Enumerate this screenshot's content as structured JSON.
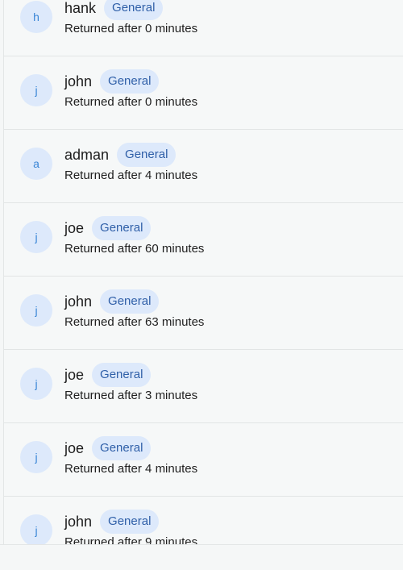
{
  "items": [
    {
      "initial": "h",
      "name": "hank",
      "badge": "General",
      "status": "Returned after 0 minutes"
    },
    {
      "initial": "j",
      "name": "john",
      "badge": "General",
      "status": "Returned after 0 minutes"
    },
    {
      "initial": "a",
      "name": "adman",
      "badge": "General",
      "status": "Returned after 4 minutes"
    },
    {
      "initial": "j",
      "name": "joe",
      "badge": "General",
      "status": "Returned after 60 minutes"
    },
    {
      "initial": "j",
      "name": "john",
      "badge": "General",
      "status": "Returned after 63 minutes"
    },
    {
      "initial": "j",
      "name": "joe",
      "badge": "General",
      "status": "Returned after 3 minutes"
    },
    {
      "initial": "j",
      "name": "joe",
      "badge": "General",
      "status": "Returned after 4 minutes"
    },
    {
      "initial": "j",
      "name": "john",
      "badge": "General",
      "status": "Returned after 9 minutes"
    }
  ],
  "colors": {
    "avatar_bg": "#dde9fb",
    "avatar_text": "#3a86d6",
    "badge_bg": "#dde9fb",
    "badge_text": "#2f5fa8",
    "background": "#f6f8f8"
  }
}
